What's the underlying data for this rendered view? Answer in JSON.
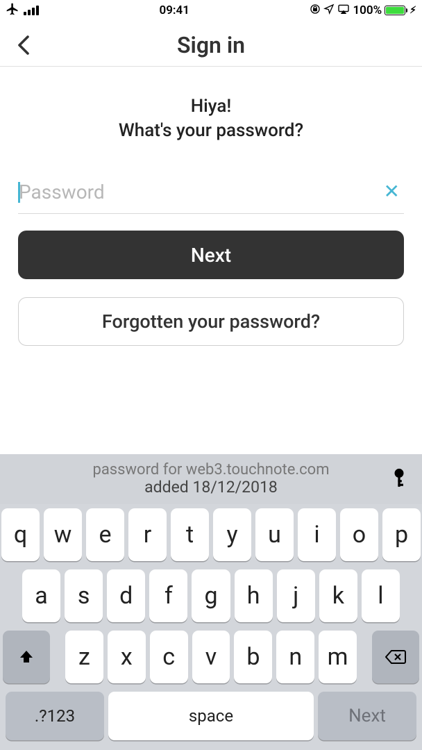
{
  "status": {
    "time": "09:41",
    "battery_pct": "100%"
  },
  "nav": {
    "title": "Sign in"
  },
  "page": {
    "greeting_line1": "Hiya!",
    "greeting_line2": "What's your password?",
    "password_placeholder": "Password",
    "next_label": "Next",
    "forgot_label": "Forgotten your password?"
  },
  "keyboard": {
    "suggest_line1": "password for web3.touchnote.com",
    "suggest_line2": "added 18/12/2018",
    "row1": [
      "q",
      "w",
      "e",
      "r",
      "t",
      "y",
      "u",
      "i",
      "o",
      "p"
    ],
    "row2": [
      "a",
      "s",
      "d",
      "f",
      "g",
      "h",
      "j",
      "k",
      "l"
    ],
    "row3": [
      "z",
      "x",
      "c",
      "v",
      "b",
      "n",
      "m"
    ],
    "num_label": ".?123",
    "space_label": "space",
    "next_label": "Next"
  }
}
